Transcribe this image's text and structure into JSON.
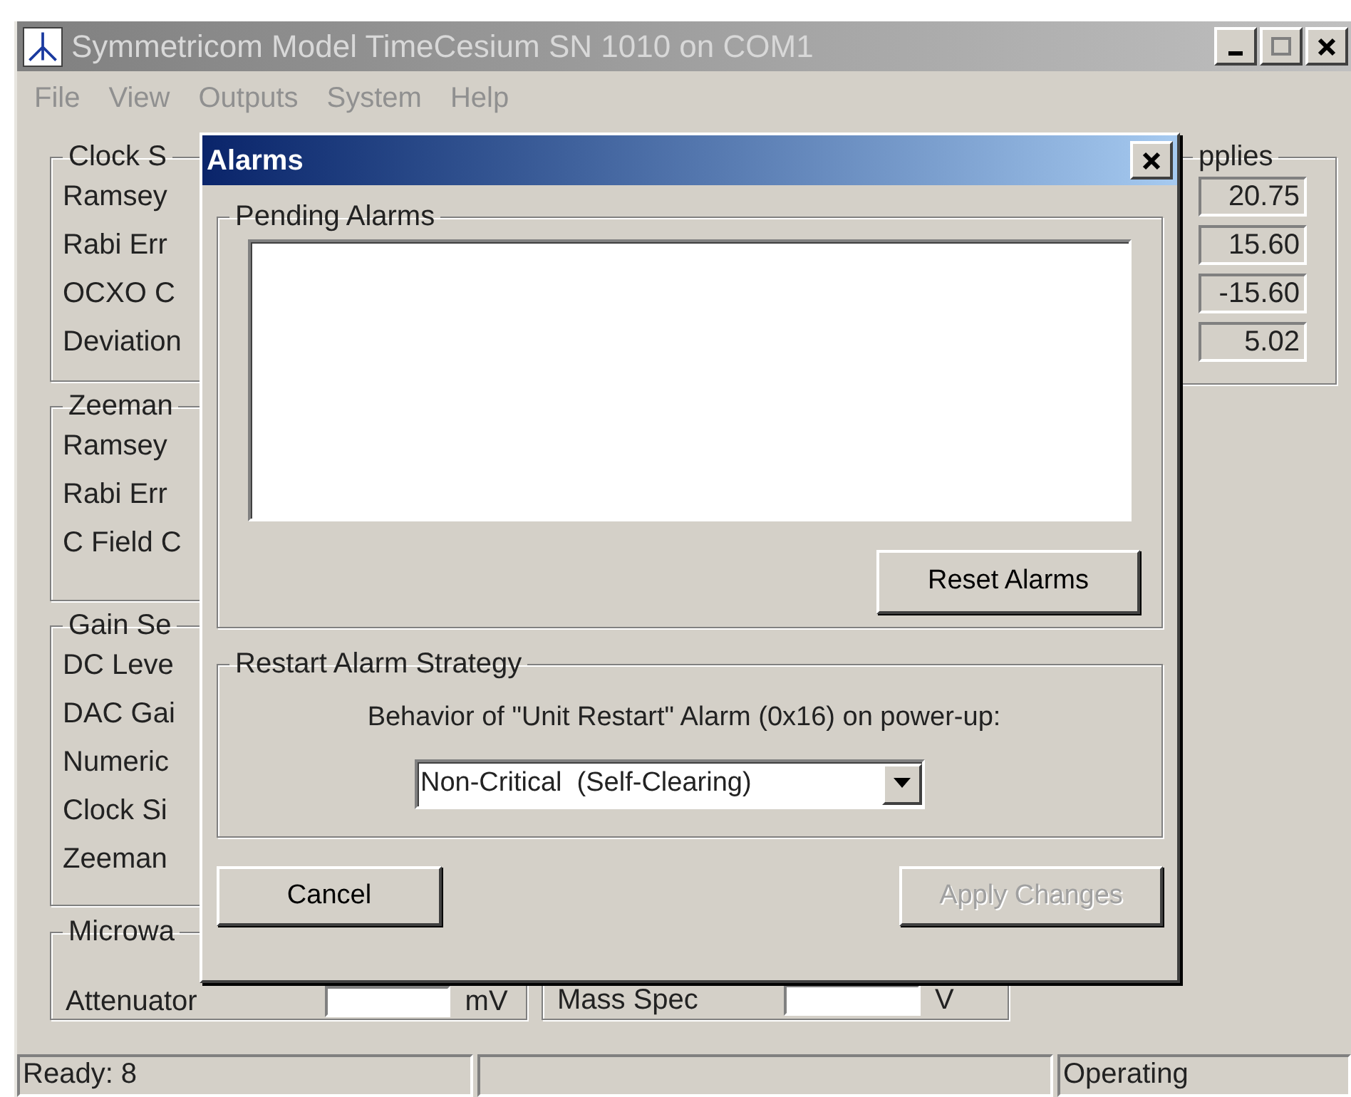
{
  "window": {
    "title": "Symmetricom Model TimeCesium SN 1010 on COM1"
  },
  "menu": [
    "File",
    "View",
    "Outputs",
    "System",
    "Help"
  ],
  "groups": [
    {
      "legend": "Clock S",
      "rows": [
        "Ramsey",
        "Rabi Err",
        "OCXO C",
        "Deviation"
      ]
    },
    {
      "legend": "Zeeman",
      "rows": [
        "Ramsey",
        "Rabi Err",
        "C Field C"
      ]
    },
    {
      "legend": "Gain Se",
      "rows": [
        "DC Leve",
        "DAC Gai",
        "Numeric",
        "Clock Si",
        "Zeeman"
      ]
    }
  ],
  "supplies": {
    "legend": "pplies",
    "values": [
      "20.75",
      "15.60",
      "-15.60",
      "5.02"
    ]
  },
  "bottom_groups": [
    {
      "legend": "Microwa",
      "label": "Attenuator",
      "unit": "mV"
    },
    {
      "label": "Mass Spec",
      "unit": "V"
    }
  ],
  "dialog": {
    "title": "Alarms",
    "pending_legend": "Pending Alarms",
    "reset_button": "Reset Alarms",
    "restart_legend": "Restart Alarm Strategy",
    "behavior_label": "Behavior of \"Unit Restart\" Alarm (0x16) on power-up:",
    "strategy_value": "Non-Critical  (Self-Clearing)",
    "cancel_button": "Cancel",
    "apply_button": {
      "label": "Apply Changes",
      "disabled": true
    }
  },
  "status_bar": {
    "left": "Ready: 8",
    "right": "Operating"
  }
}
